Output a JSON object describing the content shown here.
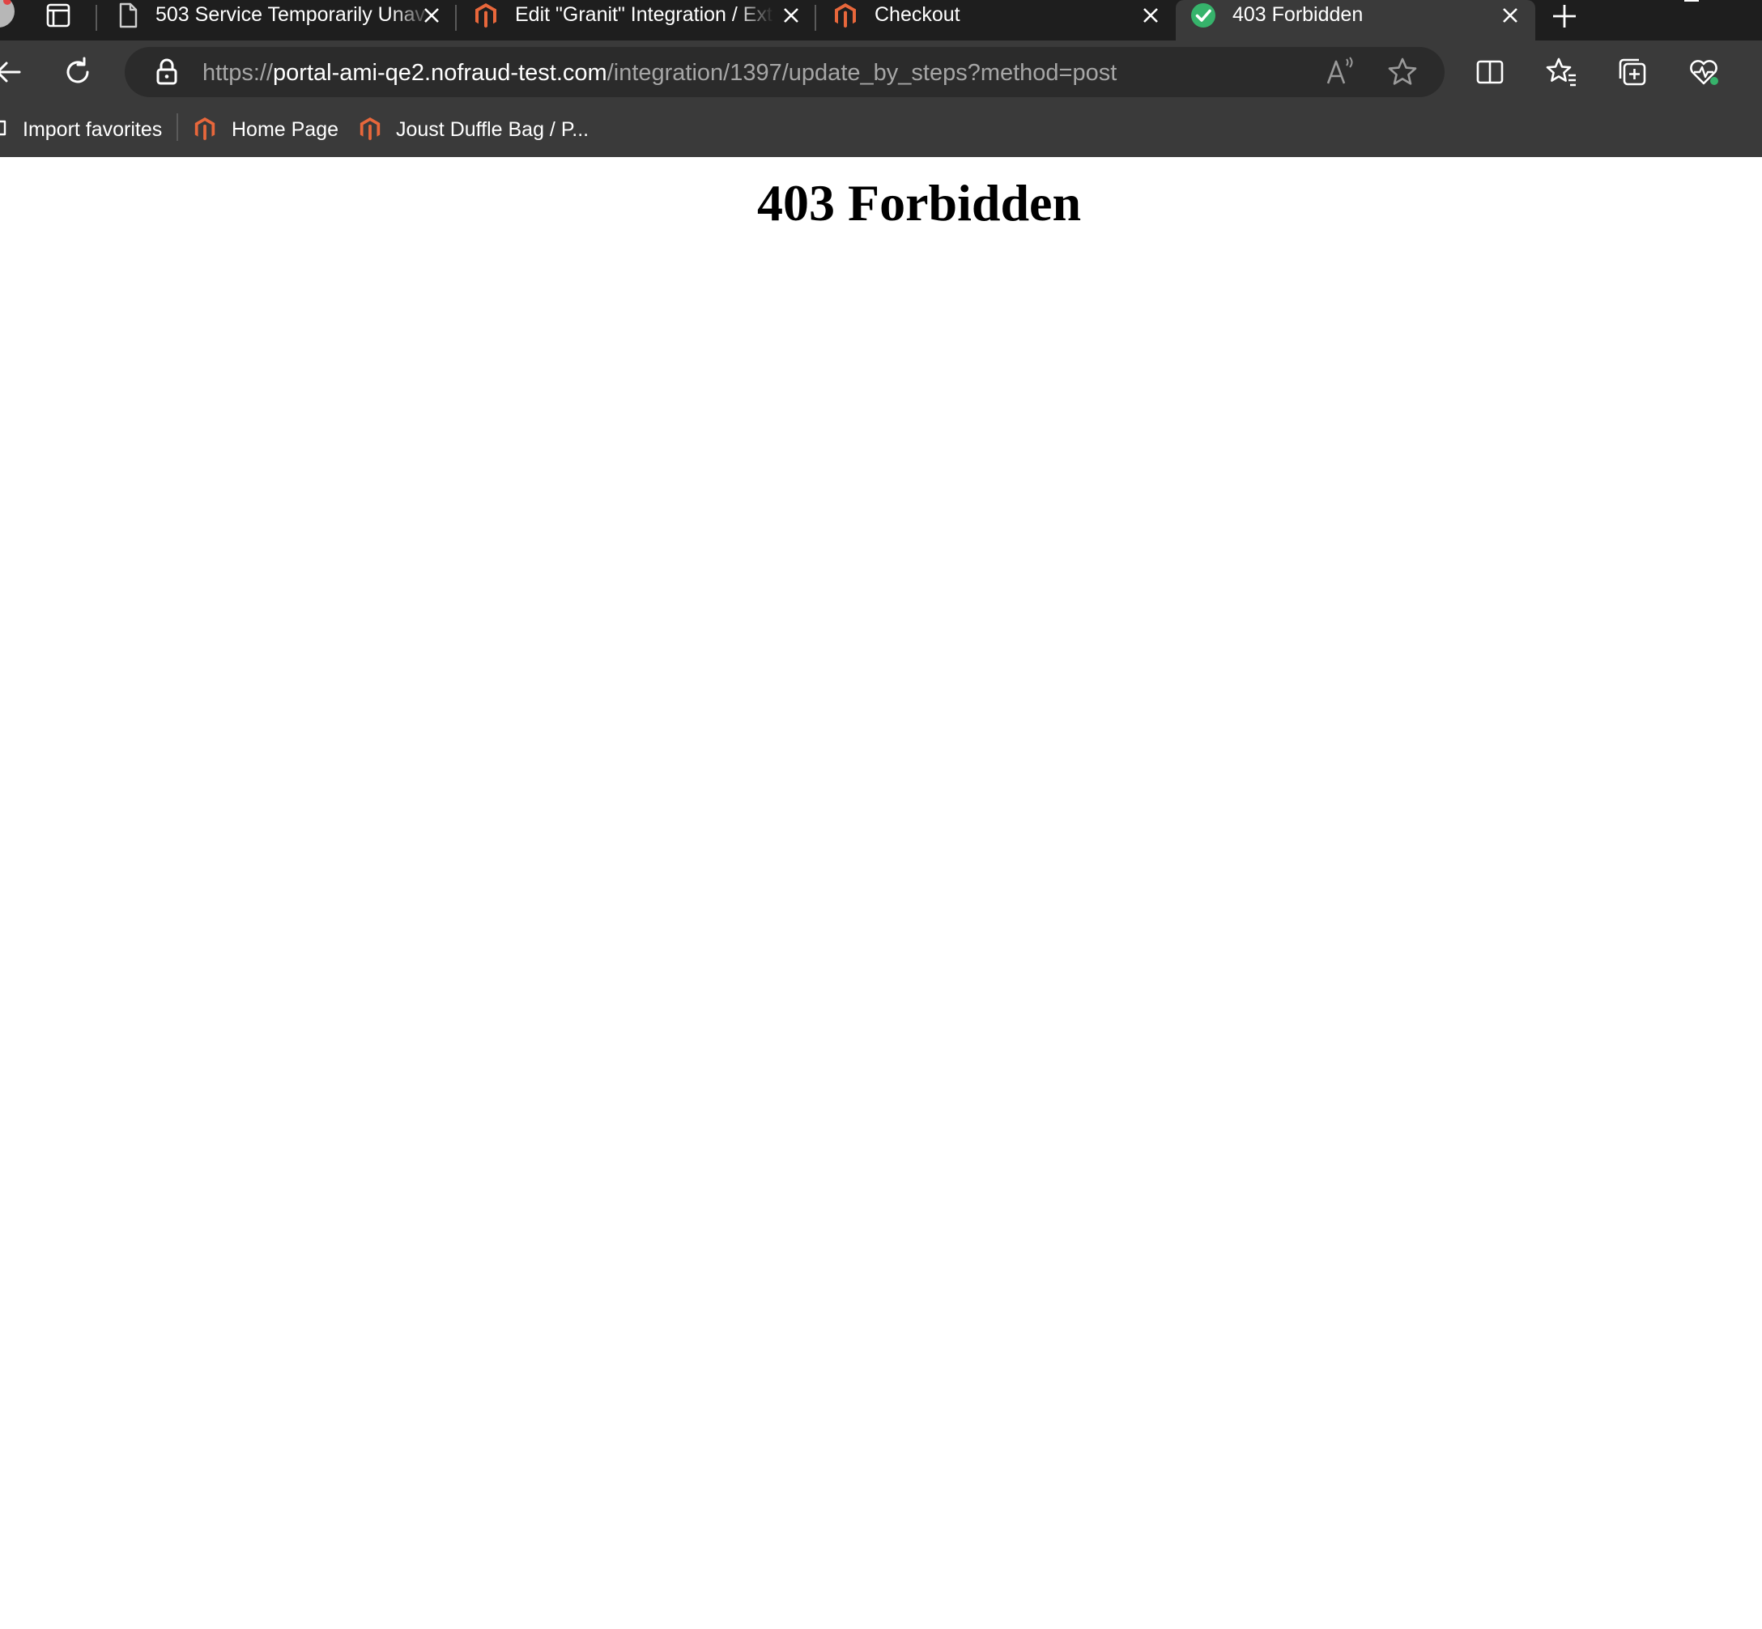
{
  "browser": {
    "tabs": [
      {
        "title": "503 Service Temporarily Unav",
        "favicon": "document-icon",
        "active": false
      },
      {
        "title": "Edit \"Granit\" Integration / Ext",
        "favicon": "magento-icon",
        "active": false
      },
      {
        "title": "Checkout",
        "favicon": "magento-icon",
        "active": false
      },
      {
        "title": "403 Forbidden",
        "favicon": "green-check-icon",
        "active": true
      }
    ],
    "new_tab_icon": "plus-icon",
    "address": {
      "scheme": "https://",
      "host": "portal-ami-qe2.nofraud-test.com",
      "path": "/integration/1397/update_by_steps?method=post"
    },
    "favorites": [
      {
        "label": "Import favorites",
        "icon": "import-favorites-icon"
      },
      {
        "label": "Home Page",
        "icon": "magento-icon"
      },
      {
        "label": "Joust Duffle Bag / P...",
        "icon": "magento-icon"
      }
    ],
    "toolbar_icons": [
      "back-arrow-icon",
      "refresh-icon",
      "lock-icon",
      "read-aloud-icon",
      "star-icon",
      "split-screen-icon",
      "favorites-icon",
      "collections-icon",
      "browser-essentials-icon"
    ]
  },
  "page": {
    "heading": "403 Forbidden"
  },
  "colors": {
    "tabstrip_bg": "#1e1e1e",
    "toolbar_bg": "#3a3a3a",
    "addressbar_bg": "#2b2b2b",
    "magento_orange": "#e8673b",
    "check_green": "#36b36b"
  }
}
